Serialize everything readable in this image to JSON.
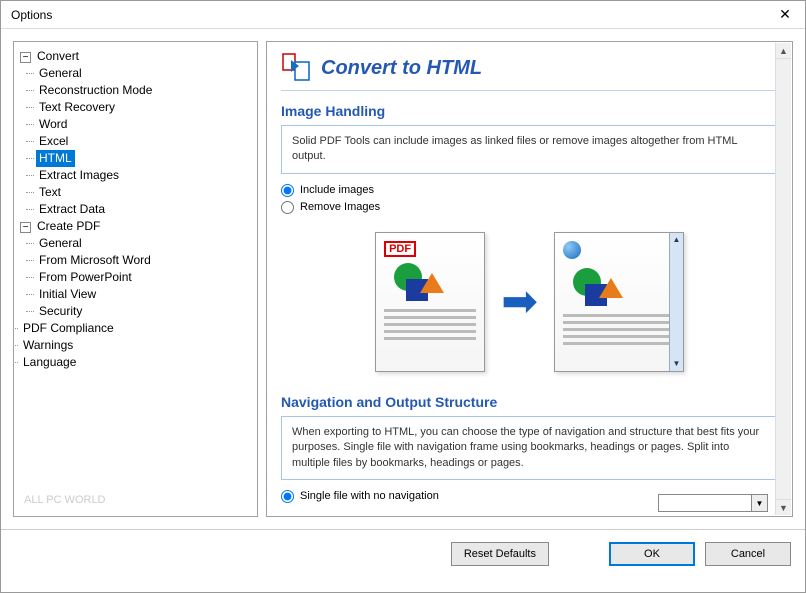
{
  "window": {
    "title": "Options"
  },
  "tree": {
    "convert": {
      "label": "Convert",
      "children": [
        "General",
        "Reconstruction Mode",
        "Text Recovery",
        "Word",
        "Excel",
        "HTML",
        "Extract Images",
        "Text",
        "Extract Data"
      ]
    },
    "createPdf": {
      "label": "Create PDF",
      "children": [
        "General",
        "From Microsoft Word",
        "From PowerPoint",
        "Initial View",
        "Security"
      ]
    },
    "pdfCompliance": "PDF Compliance",
    "warnings": "Warnings",
    "language": "Language",
    "selected": "HTML"
  },
  "content": {
    "pageTitle": "Convert to HTML",
    "section1": {
      "title": "Image Handling",
      "info": "Solid PDF Tools can include images as linked files or remove images altogether from HTML output.",
      "radio1": "Include images",
      "radio2": "Remove Images"
    },
    "illustration": {
      "pdfBadge": "PDF"
    },
    "section2": {
      "title": "Navigation and Output Structure",
      "info": "When exporting to HTML, you can choose the type of navigation and structure that best fits your purposes. Single file with navigation frame using bookmarks, headings or pages. Split into multiple files by bookmarks, headings or pages.",
      "radio1": "Single file with no navigation"
    }
  },
  "footer": {
    "reset": "Reset Defaults",
    "ok": "OK",
    "cancel": "Cancel"
  },
  "watermark": "ALL PC WORLD"
}
